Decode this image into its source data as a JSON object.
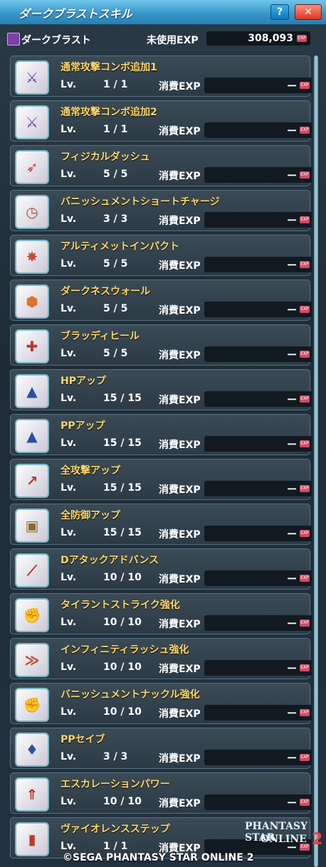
{
  "window": {
    "title": "ダークブラストスキル",
    "help_label": "?",
    "close_label": "✕"
  },
  "header": {
    "label": "ダークブラスト",
    "unused_exp_label": "未使用EXP",
    "unused_exp_value": "308,093",
    "exp_badge": "EXP"
  },
  "level_label": "Lv.",
  "cost_label": "消費EXP",
  "skills": [
    {
      "name": "通常攻撃コンボ追加1",
      "level": "1 / 1",
      "cost": "ー",
      "icon": "combo-sword-icon"
    },
    {
      "name": "通常攻撃コンボ追加2",
      "level": "1 / 1",
      "cost": "ー",
      "icon": "combo-sword-icon"
    },
    {
      "name": "フィジカルダッシュ",
      "level": "5 / 5",
      "cost": "ー",
      "icon": "dash-arrow-icon"
    },
    {
      "name": "バニッシュメントショートチャージ",
      "level": "3 / 3",
      "cost": "ー",
      "icon": "clock-charge-icon"
    },
    {
      "name": "アルティメットインパクト",
      "level": "5 / 5",
      "cost": "ー",
      "icon": "impact-burst-icon"
    },
    {
      "name": "ダークネスウォール",
      "level": "5 / 5",
      "cost": "ー",
      "icon": "hex-wall-icon"
    },
    {
      "name": "ブラッディヒール",
      "level": "5 / 5",
      "cost": "ー",
      "icon": "hp-heal-icon"
    },
    {
      "name": "HPアップ",
      "level": "15 / 15",
      "cost": "ー",
      "icon": "hp-up-icon"
    },
    {
      "name": "PPアップ",
      "level": "15 / 15",
      "cost": "ー",
      "icon": "pp-up-icon"
    },
    {
      "name": "全攻撃アップ",
      "level": "15 / 15",
      "cost": "ー",
      "icon": "attack-up-icon"
    },
    {
      "name": "全防御アップ",
      "level": "15 / 15",
      "cost": "ー",
      "icon": "defense-up-icon"
    },
    {
      "name": "Dアタックアドバンス",
      "level": "10 / 10",
      "cost": "ー",
      "icon": "sword-advance-icon"
    },
    {
      "name": "タイラントストライク強化",
      "level": "10 / 10",
      "cost": "ー",
      "icon": "strike-boost-icon"
    },
    {
      "name": "インフィニティラッシュ強化",
      "level": "10 / 10",
      "cost": "ー",
      "icon": "rush-boost-icon"
    },
    {
      "name": "バニッシュメントナックル強化",
      "level": "10 / 10",
      "cost": "ー",
      "icon": "knuckle-boost-icon"
    },
    {
      "name": "PPセイブ",
      "level": "3 / 3",
      "cost": "ー",
      "icon": "pp-save-icon"
    },
    {
      "name": "エスカレーションパワー",
      "level": "10 / 10",
      "cost": "ー",
      "icon": "escalation-icon"
    },
    {
      "name": "ヴァイオレンスステップ",
      "level": "1 / 1",
      "cost": "ー",
      "icon": "step-icon"
    }
  ],
  "footer": {
    "copyright": "©SEGA PHANTASY STAR ONLINE 2",
    "logo_line1": "PHANTASY STAR",
    "logo_line2": "ONLINE",
    "logo_number": "2"
  }
}
